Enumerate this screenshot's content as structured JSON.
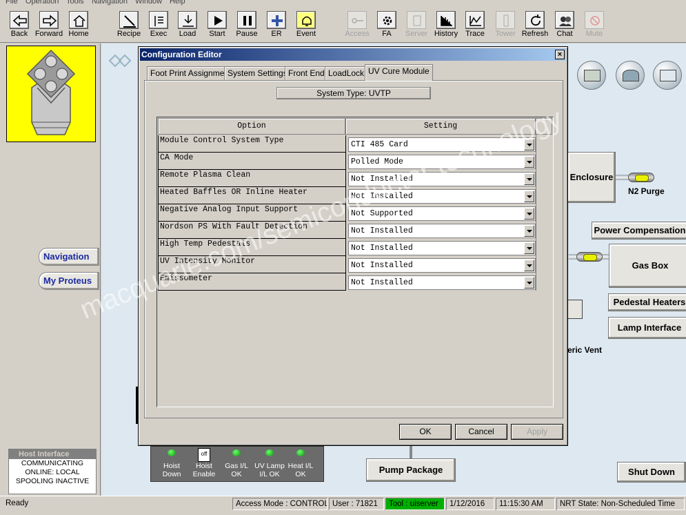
{
  "menu": [
    "File",
    "Operation",
    "Tools",
    "Navigation",
    "Window",
    "Help"
  ],
  "toolbar": [
    {
      "label": "Back",
      "icon": "back-arrow-icon",
      "enabled": true
    },
    {
      "label": "Forward",
      "icon": "forward-arrow-icon",
      "enabled": true
    },
    {
      "label": "Home",
      "icon": "home-icon",
      "enabled": true
    },
    {
      "label": "Recipe",
      "icon": "recipe-icon",
      "enabled": true
    },
    {
      "label": "Exec",
      "icon": "exec-icon",
      "enabled": true
    },
    {
      "label": "Load",
      "icon": "load-icon",
      "enabled": true
    },
    {
      "label": "Start",
      "icon": "play-icon",
      "enabled": true
    },
    {
      "label": "Pause",
      "icon": "pause-icon",
      "enabled": true
    },
    {
      "label": "ER",
      "icon": "plus-icon",
      "enabled": true
    },
    {
      "label": "Event",
      "icon": "bell-icon",
      "enabled": true
    },
    {
      "label": "Access",
      "icon": "key-icon",
      "enabled": false
    },
    {
      "label": "FA",
      "icon": "gear-icon",
      "enabled": true
    },
    {
      "label": "Server",
      "icon": "server-icon",
      "enabled": false
    },
    {
      "label": "History",
      "icon": "history-chart-icon",
      "enabled": true
    },
    {
      "label": "Trace",
      "icon": "trace-chart-icon",
      "enabled": true
    },
    {
      "label": "Tower",
      "icon": "tower-icon",
      "enabled": false
    },
    {
      "label": "Refresh",
      "icon": "refresh-icon",
      "enabled": true
    },
    {
      "label": "Chat",
      "icon": "chat-icon",
      "enabled": true
    },
    {
      "label": "Mute",
      "icon": "mute-icon",
      "enabled": false
    }
  ],
  "left": {
    "navigation_label": "Navigation",
    "my_proteus_label": "My Proteus",
    "host_title": "Host Interface",
    "host_lines": [
      "COMMUNICATING",
      "ONLINE: LOCAL",
      "SPOOLING INACTIVE"
    ]
  },
  "main": {
    "enclosure": "Enclosure",
    "n2_purge": "N2 Purge",
    "power_comp": "Power Compensation",
    "gas_box": "Gas Box",
    "pedestal_heaters": "Pedestal Heaters",
    "lamp_interface": "Lamp Interface",
    "vent_partial": "eric Vent",
    "pump_package": "Pump Package",
    "shut_down": "Shut Down",
    "status_panel": [
      {
        "label": "Hoist Down",
        "kind": "led"
      },
      {
        "label": "Hoist Enable",
        "kind": "switch",
        "switch_text": "off"
      },
      {
        "label": "Gas I/L OK",
        "kind": "led"
      },
      {
        "label": "UV Lamp I/L OK",
        "kind": "led"
      },
      {
        "label": "Heat I/L OK",
        "kind": "led"
      }
    ]
  },
  "dialog": {
    "title": "Configuration Editor",
    "close_glyph": "×",
    "tabs": [
      "Foot Print Assignment",
      "System Settings",
      "Front End",
      "LoadLock",
      "UV Cure Module"
    ],
    "active_tab": 4,
    "system_type": "System Type: UVTP",
    "col_option": "Option",
    "col_setting": "Setting",
    "rows": [
      {
        "option": "Module Control System Type",
        "setting": "CTI 485 Card"
      },
      {
        "option": "CA Mode",
        "setting": "Polled Mode"
      },
      {
        "option": "Remote Plasma Clean",
        "setting": "Not Installed"
      },
      {
        "option": "Heated Baffles OR Inline Heater",
        "setting": "Not Installed"
      },
      {
        "option": "Negative Analog Input Support",
        "setting": "Not Supported"
      },
      {
        "option": "Nordson PS With Fault Detection",
        "setting": "Not Installed"
      },
      {
        "option": "High Temp Pedestals",
        "setting": "Not Installed"
      },
      {
        "option": "UV Intensity Monitor",
        "setting": "Not Installed"
      },
      {
        "option": "Emissometer",
        "setting": "Not Installed"
      }
    ],
    "ok_label": "OK",
    "cancel_label": "Cancel",
    "apply_label": "Apply"
  },
  "statusbar": {
    "ready": "Ready",
    "access_mode": "Access Mode : CONTROL",
    "user": "User :  71821",
    "tool": "Tool :   uiserver",
    "date": "1/12/2016",
    "time": "11:15:30 AM",
    "nrt_state": "NRT State: Non-Scheduled Time"
  },
  "watermark": "macquarie.com/semiconductor technology",
  "colors": {
    "dialog_title_start": "#0a246a",
    "dialog_title_end": "#a6caf0",
    "logo_bg": "#ffff00",
    "tool_status_bg": "#00b000",
    "led_green": "#22cc22"
  }
}
